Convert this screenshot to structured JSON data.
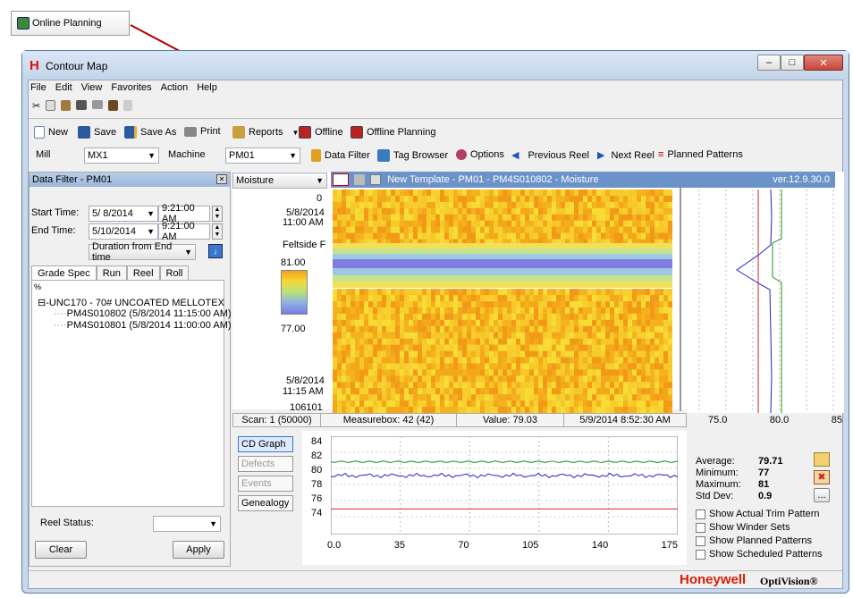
{
  "callout": {
    "label": "Online Planning"
  },
  "window": {
    "title": "Contour Map",
    "min": "–",
    "max": "□",
    "close": "✕"
  },
  "menu": [
    "File",
    "Edit",
    "View",
    "Favorites",
    "Action",
    "Help"
  ],
  "toolbar1": {
    "new": "New",
    "save": "Save",
    "save_as": "Save As",
    "print": "Print",
    "reports": "Reports",
    "offline": "Offline",
    "offline_planning": "Offline Planning"
  },
  "toolbar2": {
    "mill_label": "Mill",
    "mill_value": "MX1",
    "machine_label": "Machine",
    "machine_value": "PM01",
    "data_filter": "Data Filter",
    "tag_browser": "Tag Browser",
    "options": "Options",
    "previous_reel": "Previous Reel",
    "next_reel": "Next Reel",
    "planned_patterns": "Planned Patterns"
  },
  "filter": {
    "title": "Data Filter - PM01",
    "start_label": "Start Time:",
    "start_date": "5/ 8/2014",
    "start_time": "9:21:00 AM",
    "end_label": "End Time:",
    "end_date": "5/10/2014",
    "end_time": "9:21:00 AM",
    "duration": "Duration from End time",
    "tabs": [
      "Grade Spec",
      "Run",
      "Reel",
      "Roll"
    ],
    "percent": "%",
    "tree_root": "UNC170 - 70# UNCOATED MELLOTEX",
    "tree_items": [
      "PM4S010802 (5/8/2014 11:15:00 AM)",
      "PM4S010801 (5/8/2014 11:00:00 AM)"
    ],
    "reel_status_label": "Reel Status:",
    "clear": "Clear",
    "apply": "Apply"
  },
  "map": {
    "measurement": "Moisture",
    "header": "New Template - PM01 - PM4S010802 - Moisture",
    "version": "ver.12.9.30.0",
    "top_index": "0",
    "top_date": "5/8/2014",
    "top_time": "11:00 AM",
    "side_label": "Feltside F",
    "scale_max": "81.00",
    "scale_min": "77.00",
    "bottom_date": "5/8/2014",
    "bottom_time": "11:15 AM",
    "bottom_index": "106101",
    "profile_ticks": [
      "75.0",
      "80.0",
      "85"
    ]
  },
  "status": {
    "scan": "Scan: 1 (50000)",
    "measurebox": "Measurebox: 42 (42)",
    "value": "Value: 79.03",
    "time": "5/9/2014 8:52:30 AM"
  },
  "sidebuttons": [
    "CD Graph",
    "Defects",
    "Events",
    "Genealogy"
  ],
  "trend": {
    "yticks": [
      "84",
      "82",
      "80",
      "78",
      "76",
      "74"
    ],
    "xticks": [
      "0.0",
      "35",
      "70",
      "105",
      "140",
      "175"
    ]
  },
  "stats": {
    "average_label": "Average:",
    "average": "79.71",
    "minimum_label": "Minimum:",
    "minimum": "77",
    "maximum_label": "Maximum:",
    "maximum": "81",
    "std_label": "Std Dev:",
    "std": "0.9",
    "more": "..."
  },
  "checks": [
    "Show Actual Trim Pattern",
    "Show Winder Sets",
    "Show Planned Patterns",
    "Show Scheduled Patterns"
  ],
  "brand": {
    "honeywell": "Honeywell",
    "product": "OptiVision®"
  },
  "colors": {
    "accent": "#1a55a0",
    "title_bar_blue": "#6b93c9",
    "close_red": "#c8463d"
  }
}
